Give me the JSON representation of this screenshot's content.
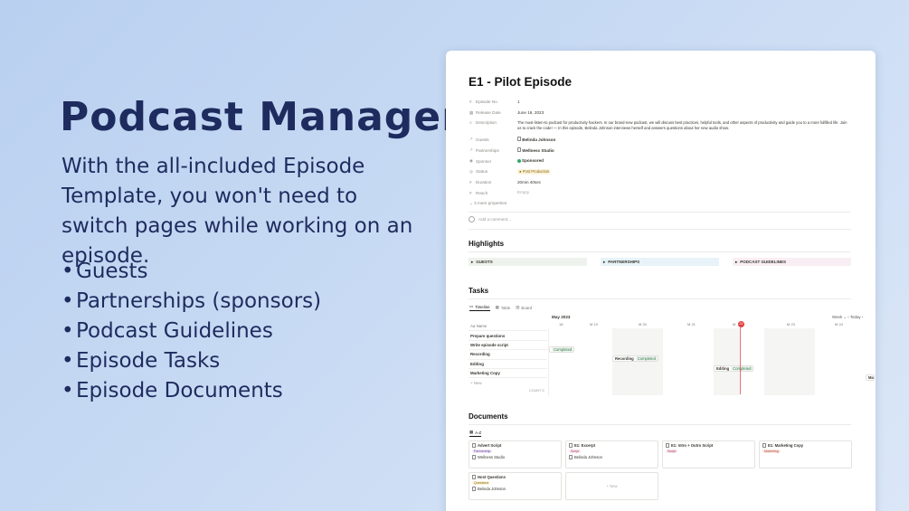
{
  "hero": {
    "title": "Podcast Manager",
    "subtitle": "With the all-included Episode Template, you won't need to switch pages while working on an episode.",
    "bullets": [
      "Guests",
      "Partnerships (sponsors)",
      "Podcast Guidelines",
      "Episode Tasks",
      "Episode Documents"
    ]
  },
  "page": {
    "title": "E1 - Pilot Episode",
    "properties": [
      {
        "icon": "#",
        "key": "Episode No",
        "value": "1"
      },
      {
        "icon": "▦",
        "key": "Release Date",
        "value": "June 16, 2023"
      },
      {
        "icon": "≡",
        "key": "Description",
        "value": "The must-listen-to podcast for productivity hackers. In our brand-new podcast, we will discuss best practices, helpful tools, and other aspects of productivity and guide you to a more fulfilled life. Join us to crack the code! — In this episode, Belinda Johnson interviews herself and answers questions about her new audio show."
      },
      {
        "icon": "↗",
        "key": "Guests",
        "value": "Belinda Johnson"
      },
      {
        "icon": "↗",
        "key": "Partnerships",
        "value": "Wellness Studio"
      },
      {
        "icon": "◉",
        "key": "Sponsor",
        "value": "Sponsored"
      },
      {
        "icon": "◎",
        "key": "Status",
        "value": "Post Production"
      },
      {
        "icon": "#",
        "key": "Duration",
        "value": "20min 40sec"
      },
      {
        "icon": "#",
        "key": "Reach",
        "value": "Empty"
      }
    ],
    "more_properties": "3 more properties",
    "add_comment": "Add a comment...",
    "highlights_title": "Highlights",
    "highlights": [
      "GUESTS",
      "PARTNERSHIPS",
      "PODCAST GUIDELINES"
    ],
    "tasks_title": "Tasks",
    "task_views": [
      "Timeline",
      "Table",
      "Board"
    ],
    "timeline": {
      "month": "May 2023",
      "controls": "Week ⌄  ‹  Today  ›",
      "weeks": [
        "18",
        "19",
        "20",
        "21",
        "22",
        "23",
        "24"
      ],
      "today": "22",
      "name_header": "Name",
      "rows": [
        "Prepare questions",
        "Write episode script",
        "Recording",
        "Editing",
        "Marketing Copy"
      ],
      "new_label": "+ New",
      "count": "COUNT 5",
      "bars": [
        {
          "label": "",
          "status": "Completed"
        },
        {
          "label": "Recording",
          "status": "Completed"
        },
        {
          "label": "Editing",
          "status": "Completed"
        },
        {
          "label": "Ma",
          "status": ""
        }
      ]
    },
    "documents_title": "Documents",
    "documents_view": "A-Z",
    "documents": [
      {
        "title": "Advert Script",
        "tag": "Partnership",
        "who": "Wellness Studio"
      },
      {
        "title": "E1: Excerpt",
        "tag": "Script",
        "who": "Belinda Johnson"
      },
      {
        "title": "E1: Intro + Outro Script",
        "tag": "Script",
        "who": ""
      },
      {
        "title": "E1: Marketing Copy",
        "tag": "Marketing",
        "who": ""
      },
      {
        "title": "Host Questions",
        "tag": "Questions",
        "who": "Belinda Johnson"
      }
    ],
    "new_doc": "+ New"
  }
}
